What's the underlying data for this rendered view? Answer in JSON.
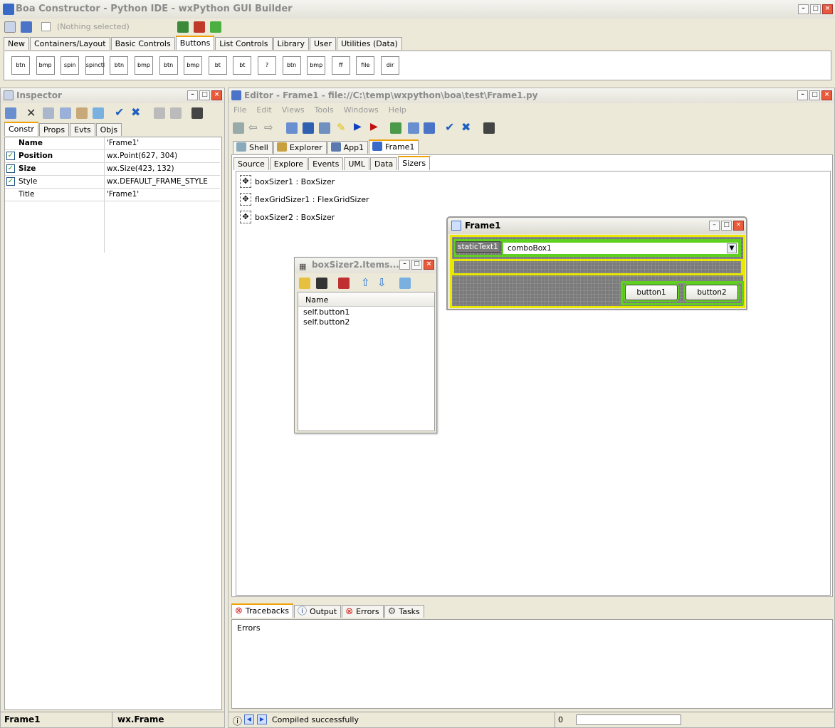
{
  "app": {
    "title": "Boa Constructor - Python IDE - wxPython GUI Builder",
    "selection": "(Nothing selected)"
  },
  "palette": {
    "tabs": [
      "New",
      "Containers/Layout",
      "Basic Controls",
      "Buttons",
      "List Controls",
      "Library",
      "User",
      "Utilities (Data)"
    ],
    "selected_tab": "Buttons",
    "buttons": [
      "btn",
      "bmp",
      "spin",
      "spinctl",
      "btn",
      "bmp",
      "btn",
      "bmp",
      "bt",
      "bt",
      "?",
      "btn",
      "bmp",
      "ff",
      "file",
      "dir"
    ]
  },
  "inspector": {
    "title": "Inspector",
    "tabs": [
      "Constr",
      "Props",
      "Evts",
      "Objs"
    ],
    "rows": [
      {
        "name": "Name",
        "value": "'Frame1'",
        "bold": true,
        "check": false
      },
      {
        "name": "Position",
        "value": "wx.Point(627, 304)",
        "bold": true,
        "check": true
      },
      {
        "name": "Size",
        "value": "wx.Size(423, 132)",
        "bold": true,
        "check": true
      },
      {
        "name": "Style",
        "value": "wx.DEFAULT_FRAME_STYLE",
        "bold": false,
        "check": true
      },
      {
        "name": "Title",
        "value": "'Frame1'",
        "bold": false,
        "check": false
      }
    ],
    "status_name": "Frame1",
    "status_class": "wx.Frame"
  },
  "editor": {
    "title": "Editor - Frame1 - file://C:\\temp\\wxpython\\boa\\test\\Frame1.py",
    "menu": [
      "File",
      "Edit",
      "Views",
      "Tools",
      "Windows",
      "Help"
    ],
    "file_tabs": [
      "Shell",
      "Explorer",
      "App1",
      "Frame1"
    ],
    "view_tabs": [
      "Source",
      "Explore",
      "Events",
      "UML",
      "Data",
      "Sizers"
    ],
    "sizers": [
      "boxSizer1 : BoxSizer",
      "flexGridSizer1 : FlexGridSizer",
      "boxSizer2 : BoxSizer"
    ],
    "bottom_tabs": [
      "Tracebacks",
      "Output",
      "Errors",
      "Tasks"
    ],
    "bottom_content": "Errors",
    "status": "Compiled successfully",
    "status_num": "0"
  },
  "frame1": {
    "title": "Frame1",
    "static_text": "staticText1",
    "combo": "comboBox1",
    "button1": "button1",
    "button2": "button2"
  },
  "items": {
    "title": "boxSizer2.Items...",
    "column": "Name",
    "rows": [
      "self.button1",
      "self.button2"
    ]
  }
}
